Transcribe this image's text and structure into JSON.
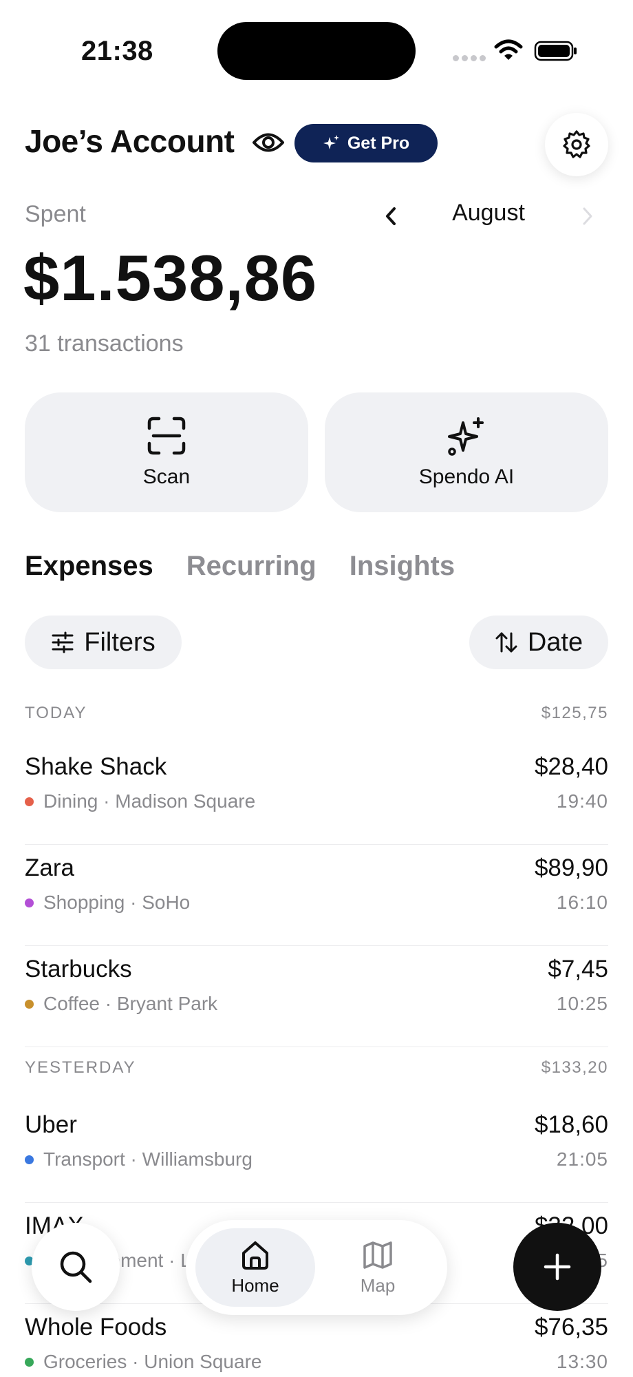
{
  "status_bar": {
    "time": "21:38"
  },
  "header": {
    "account_title": "Joe’s Account",
    "pro_badge_label": "Get Pro"
  },
  "summary": {
    "spent_label": "Spent",
    "month": "August",
    "amount": "$1.538,86",
    "transaction_count": "31 transactions"
  },
  "actions": [
    {
      "label": "Scan",
      "icon": "scan-icon"
    },
    {
      "label": "Spendo AI",
      "icon": "sparkles-icon"
    }
  ],
  "tabs": [
    {
      "label": "Expenses",
      "active": true
    },
    {
      "label": "Recurring",
      "active": false
    },
    {
      "label": "Insights",
      "active": false
    }
  ],
  "toolbar": {
    "filters_label": "Filters",
    "sort_label": "Date"
  },
  "groups": [
    {
      "title": "TODAY",
      "total": "$125,75",
      "transactions": [
        {
          "name": "Shake Shack",
          "meta": "Dining · Madison Square",
          "amount": "$28,40",
          "time": "19:40",
          "dot_color": "#e5604a"
        },
        {
          "name": "Zara",
          "meta": "Shopping · SoHo",
          "amount": "$89,90",
          "time": "16:10",
          "dot_color": "#b34fd6"
        },
        {
          "name": "Starbucks",
          "meta": "Coffee · Bryant Park",
          "amount": "$7,45",
          "time": "10:25",
          "dot_color": "#c8902c"
        }
      ]
    },
    {
      "title": "YESTERDAY",
      "total": "$133,20",
      "transactions": [
        {
          "name": "Uber",
          "meta": "Transport · Williamsburg",
          "amount": "$18,60",
          "time": "21:05",
          "dot_color": "#3a78e0"
        },
        {
          "name": "IMAX",
          "meta": "Entertainment · Lincoln Square",
          "amount": "$32,00",
          "time": "18:15",
          "dot_color": "#2d9bb0"
        },
        {
          "name": "Whole Foods",
          "meta": "Groceries · Union Square",
          "amount": "$76,35",
          "time": "13:30",
          "dot_color": "#37a85a"
        }
      ]
    }
  ],
  "bottom_nav": {
    "home_label": "Home",
    "map_label": "Map"
  },
  "colors": {
    "pro_badge": "#0f2356",
    "card_bg": "#f0f1f4",
    "muted_text": "#8a8a8e"
  }
}
